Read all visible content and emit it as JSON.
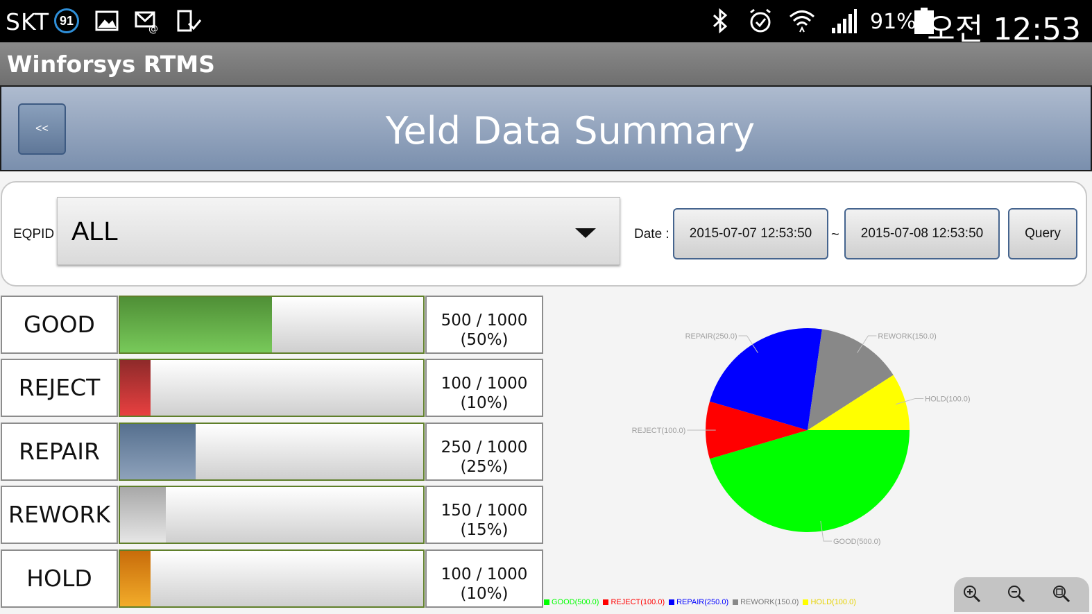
{
  "status_bar": {
    "carrier": "SKT",
    "notification_badge": "91",
    "battery": "91%",
    "time": "오전 12:53",
    "icons": [
      "gallery-icon",
      "email-icon",
      "download-icon",
      "bluetooth-icon",
      "alarm-icon",
      "wifi-icon",
      "signal-icon",
      "battery-icon"
    ]
  },
  "app_bar": {
    "title": "Winforsys RTMS"
  },
  "header": {
    "back_label": "<<",
    "title": "Yeld Data Summary"
  },
  "filter": {
    "eqpid_label": "EQPID",
    "eqpid_value": "ALL",
    "date_label": "Date :",
    "date_from": "2015-07-07 12:53:50",
    "separator": "~",
    "date_to": "2015-07-08 12:53:50",
    "query_label": "Query"
  },
  "stats": [
    {
      "label": "GOOD",
      "count": "500 / 1000",
      "percent": "(50%)",
      "ratio": 0.5,
      "fill": [
        "#4f8f36",
        "#78c95a"
      ]
    },
    {
      "label": "REJECT",
      "count": "100 / 1000",
      "percent": "(10%)",
      "ratio": 0.1,
      "fill": [
        "#8e2a2a",
        "#e84040"
      ]
    },
    {
      "label": "REPAIR",
      "count": "250 / 1000",
      "percent": "(25%)",
      "ratio": 0.25,
      "fill": [
        "#56708f",
        "#8ea2bb"
      ]
    },
    {
      "label": "REWORK",
      "count": "150 / 1000",
      "percent": "(15%)",
      "ratio": 0.15,
      "fill": [
        "#a8a8a8",
        "#e6e6e6"
      ]
    },
    {
      "label": "HOLD",
      "count": "100 / 1000",
      "percent": "(10%)",
      "ratio": 0.1,
      "fill": [
        "#c86c0a",
        "#f2ac2a"
      ]
    }
  ],
  "chart_data": {
    "type": "pie",
    "title": "",
    "categories": [
      "GOOD",
      "REJECT",
      "REPAIR",
      "REWORK",
      "HOLD"
    ],
    "values": [
      500,
      100,
      250,
      150,
      100
    ],
    "slice_labels": [
      "GOOD(500.0)",
      "REJECT(100.0)",
      "REPAIR(250.0)",
      "REWORK(150.0)",
      "HOLD(100.0)"
    ],
    "colors": [
      "#00ff00",
      "#ff0000",
      "#0000ff",
      "#888888",
      "#ffff00"
    ],
    "legend_labels": [
      "GOOD(500.0)",
      "REJECT(100.0)",
      "REPAIR(250.0)",
      "REWORK(150.0)",
      "HOLD(100.0)"
    ],
    "legend_position": "bottom-left"
  },
  "zoom_controls": [
    "zoom-in-icon",
    "zoom-out-icon",
    "zoom-reset-icon"
  ]
}
